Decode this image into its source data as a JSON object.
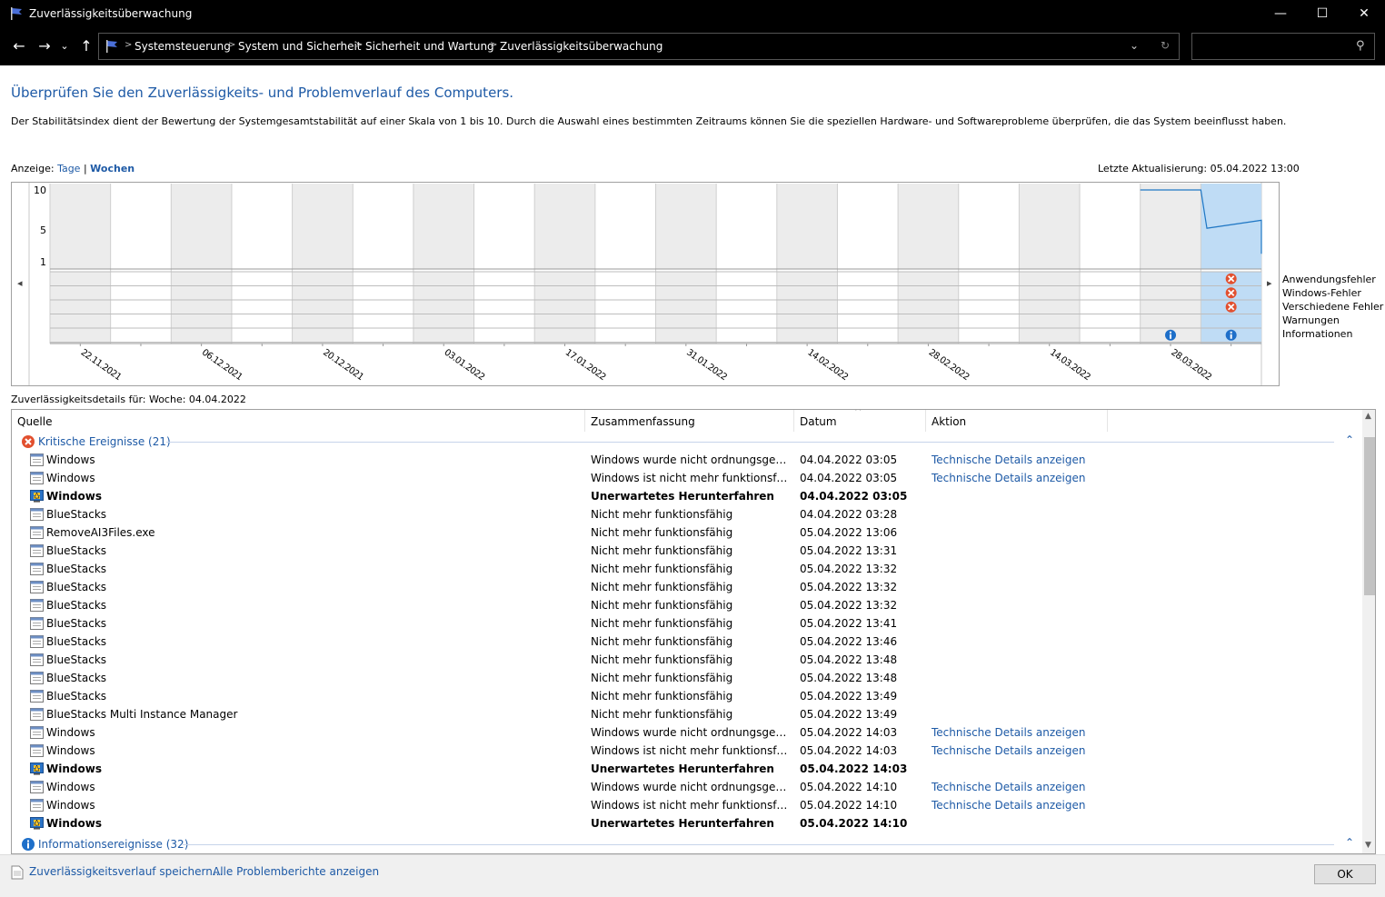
{
  "window": {
    "title": "Zuverlässigkeitsüberwachung",
    "min": "—",
    "max": "☐",
    "close": "✕"
  },
  "address": {
    "crumbs": [
      "Systemsteuerung",
      "System und Sicherheit",
      "Sicherheit und Wartung",
      "Zuverlässigkeitsüberwachung"
    ],
    "back": "←",
    "forward": "→",
    "history": "⌄",
    "up": "↑",
    "dropdown": "⌄",
    "refresh": "↻",
    "search_glyph": "⚲"
  },
  "header": {
    "title": "Überprüfen Sie den Zuverlässigkeits- und Problemverlauf des Computers.",
    "description": "Der Stabilitätsindex dient der Bewertung der Systemgesamtstabilität auf einer Skala von 1 bis 10. Durch die Auswahl eines bestimmten Zeitraums können Sie die speziellen Hardware- und Softwareprobleme überprüfen, die das System beeinflusst haben."
  },
  "view": {
    "label": "Anzeige:",
    "days": "Tage",
    "separator": "|",
    "weeks": "Wochen",
    "last_update": "Letzte Aktualisierung: 05.04.2022 13:00"
  },
  "chart_data": {
    "type": "line",
    "y_ticks": [
      "10",
      "5",
      "1"
    ],
    "ylim": [
      1,
      10
    ],
    "x_labels": [
      "22.11.2021",
      "06.12.2021",
      "20.12.2021",
      "03.01.2022",
      "17.01.2022",
      "31.01.2022",
      "14.02.2022",
      "28.02.2022",
      "14.03.2022",
      "28.03.2022"
    ],
    "week_count": 20,
    "selected_week": 19,
    "stability_series": [
      {
        "week": 18,
        "value": 10
      },
      {
        "week": 19,
        "value": 10
      },
      {
        "week": 19.1,
        "value": 5.2
      },
      {
        "week": 20,
        "value": 6.2
      },
      {
        "week": 20,
        "value": 2
      }
    ],
    "categories": [
      "Anwendungsfehler",
      "Windows-Fehler",
      "Verschiedene Fehler",
      "Warnungen",
      "Informationen"
    ],
    "events": [
      {
        "week": 19,
        "category": 0,
        "kind": "error"
      },
      {
        "week": 19,
        "category": 1,
        "kind": "error"
      },
      {
        "week": 19,
        "category": 2,
        "kind": "error"
      },
      {
        "week": 18,
        "category": 4,
        "kind": "info"
      },
      {
        "week": 19,
        "category": 4,
        "kind": "info"
      }
    ],
    "nav_left": "◂",
    "nav_right": "▸"
  },
  "details": {
    "label": "Zuverlässigkeitsdetails für: Woche: 04.04.2022",
    "columns": [
      "Quelle",
      "Zusammenfassung",
      "Datum",
      "Aktion"
    ],
    "sort_glyph": "^",
    "collapse_glyph": "⌃",
    "group_critical": "Kritische Ereignisse (21)",
    "group_info": "Informationsereignisse (32)",
    "rows": [
      {
        "source": "Windows",
        "summary": "Windows wurde nicht ordnungsgemäß heruntergefahren.",
        "date": "04.04.2022 03:05",
        "action": "Technische Details anzeigen",
        "bold": false,
        "icon": "app"
      },
      {
        "source": "Windows",
        "summary": "Windows ist nicht mehr funktionsfähig.",
        "date": "04.04.2022 03:05",
        "action": "Technische Details anzeigen",
        "bold": false,
        "icon": "app"
      },
      {
        "source": "Windows",
        "summary": "Unerwartetes Herunterfahren",
        "date": "04.04.2022 03:05",
        "action": "",
        "bold": true,
        "icon": "win"
      },
      {
        "source": "BlueStacks",
        "summary": "Nicht mehr funktionsfähig",
        "date": "04.04.2022 03:28",
        "action": "",
        "bold": false,
        "icon": "app"
      },
      {
        "source": "RemoveAI3Files.exe",
        "summary": "Nicht mehr funktionsfähig",
        "date": "05.04.2022 13:06",
        "action": "",
        "bold": false,
        "icon": "app"
      },
      {
        "source": "BlueStacks",
        "summary": "Nicht mehr funktionsfähig",
        "date": "05.04.2022 13:31",
        "action": "",
        "bold": false,
        "icon": "app"
      },
      {
        "source": "BlueStacks",
        "summary": "Nicht mehr funktionsfähig",
        "date": "05.04.2022 13:32",
        "action": "",
        "bold": false,
        "icon": "app"
      },
      {
        "source": "BlueStacks",
        "summary": "Nicht mehr funktionsfähig",
        "date": "05.04.2022 13:32",
        "action": "",
        "bold": false,
        "icon": "app"
      },
      {
        "source": "BlueStacks",
        "summary": "Nicht mehr funktionsfähig",
        "date": "05.04.2022 13:32",
        "action": "",
        "bold": false,
        "icon": "app"
      },
      {
        "source": "BlueStacks",
        "summary": "Nicht mehr funktionsfähig",
        "date": "05.04.2022 13:41",
        "action": "",
        "bold": false,
        "icon": "app"
      },
      {
        "source": "BlueStacks",
        "summary": "Nicht mehr funktionsfähig",
        "date": "05.04.2022 13:46",
        "action": "",
        "bold": false,
        "icon": "app"
      },
      {
        "source": "BlueStacks",
        "summary": "Nicht mehr funktionsfähig",
        "date": "05.04.2022 13:48",
        "action": "",
        "bold": false,
        "icon": "app"
      },
      {
        "source": "BlueStacks",
        "summary": "Nicht mehr funktionsfähig",
        "date": "05.04.2022 13:48",
        "action": "",
        "bold": false,
        "icon": "app"
      },
      {
        "source": "BlueStacks",
        "summary": "Nicht mehr funktionsfähig",
        "date": "05.04.2022 13:49",
        "action": "",
        "bold": false,
        "icon": "app"
      },
      {
        "source": "BlueStacks Multi Instance Manager",
        "summary": "Nicht mehr funktionsfähig",
        "date": "05.04.2022 13:49",
        "action": "",
        "bold": false,
        "icon": "app"
      },
      {
        "source": "Windows",
        "summary": "Windows wurde nicht ordnungsgemäß heruntergefahren.",
        "date": "05.04.2022 14:03",
        "action": "Technische Details anzeigen",
        "bold": false,
        "icon": "app"
      },
      {
        "source": "Windows",
        "summary": "Windows ist nicht mehr funktionsfähig.",
        "date": "05.04.2022 14:03",
        "action": "Technische Details anzeigen",
        "bold": false,
        "icon": "app"
      },
      {
        "source": "Windows",
        "summary": "Unerwartetes Herunterfahren",
        "date": "05.04.2022 14:03",
        "action": "",
        "bold": true,
        "icon": "win"
      },
      {
        "source": "Windows",
        "summary": "Windows wurde nicht ordnungsgemäß heruntergefahren.",
        "date": "05.04.2022 14:10",
        "action": "Technische Details anzeigen",
        "bold": false,
        "icon": "app"
      },
      {
        "source": "Windows",
        "summary": "Windows ist nicht mehr funktionsfähig.",
        "date": "05.04.2022 14:10",
        "action": "Technische Details anzeigen",
        "bold": false,
        "icon": "app"
      },
      {
        "source": "Windows",
        "summary": "Unerwartetes Herunterfahren",
        "date": "05.04.2022 14:10",
        "action": "",
        "bold": true,
        "icon": "win"
      }
    ]
  },
  "footer": {
    "save_link": "Zuverlässigkeitsverlauf speichern...",
    "reports_link": "Alle Problemberichte anzeigen",
    "ok": "OK"
  },
  "colors": {
    "link": "#1e5aa6",
    "series": "#1f77c4",
    "selected": "#bfdcf5",
    "error": "#e2502f",
    "info": "#1e6fc9"
  }
}
